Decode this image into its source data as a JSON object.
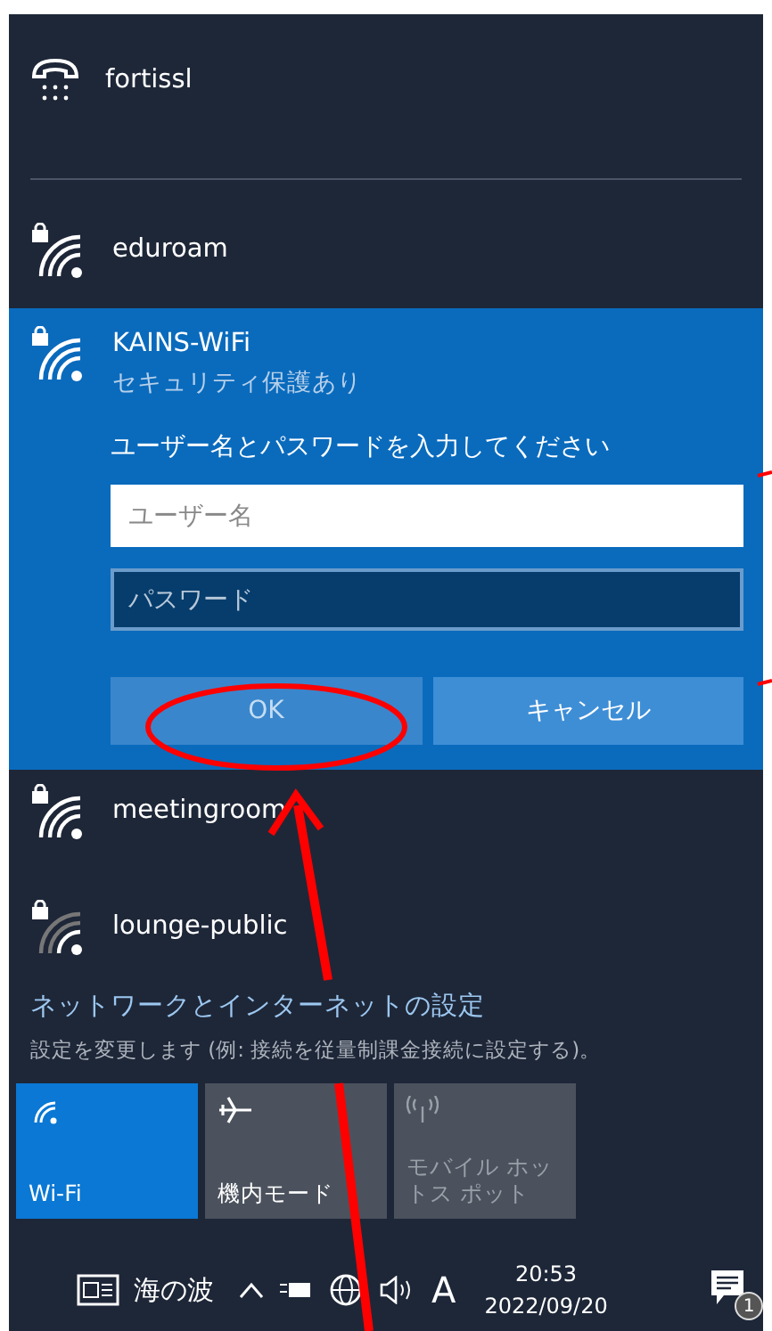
{
  "networks": [
    {
      "kind": "dialup",
      "name": "fortissl",
      "selected": false
    },
    {
      "kind": "wifi",
      "name": "eduroam",
      "secured": true,
      "selected": false,
      "weak": false
    },
    {
      "kind": "wifi",
      "name": "KAINS-WiFi",
      "secured": true,
      "selected": true,
      "weak": false,
      "status": "セキュリティ保護あり",
      "prompt": "ユーザー名とパスワードを入力してください",
      "fields": [
        {
          "placeholder": "ユーザー名",
          "focused": true
        },
        {
          "placeholder": "パスワード",
          "focused": false
        }
      ],
      "buttons": [
        {
          "label": "OK",
          "disabled": true
        },
        {
          "label": "キャンセル",
          "disabled": false
        }
      ]
    },
    {
      "kind": "wifi",
      "name": "meetingroom",
      "secured": true,
      "selected": false,
      "weak": false
    },
    {
      "kind": "wifi",
      "name": "lounge-public",
      "secured": true,
      "selected": false,
      "weak": true
    }
  ],
  "settings": {
    "link": "ネットワークとインターネットの設定",
    "description": "設定を変更します (例: 接続を従量制課金接続に設定する)。"
  },
  "tiles": [
    {
      "kind": "wifi",
      "label": "Wi-Fi",
      "on": true,
      "disabled": false
    },
    {
      "kind": "airplane",
      "label": "機内モード",
      "on": false,
      "disabled": false
    },
    {
      "kind": "hotspot",
      "label": "モバイル ホットス ポット",
      "on": false,
      "disabled": true
    }
  ],
  "taskbar": {
    "weather": "海の波",
    "ime": "A",
    "time": "20:53",
    "date": "2022/09/20",
    "notifications": "1"
  }
}
